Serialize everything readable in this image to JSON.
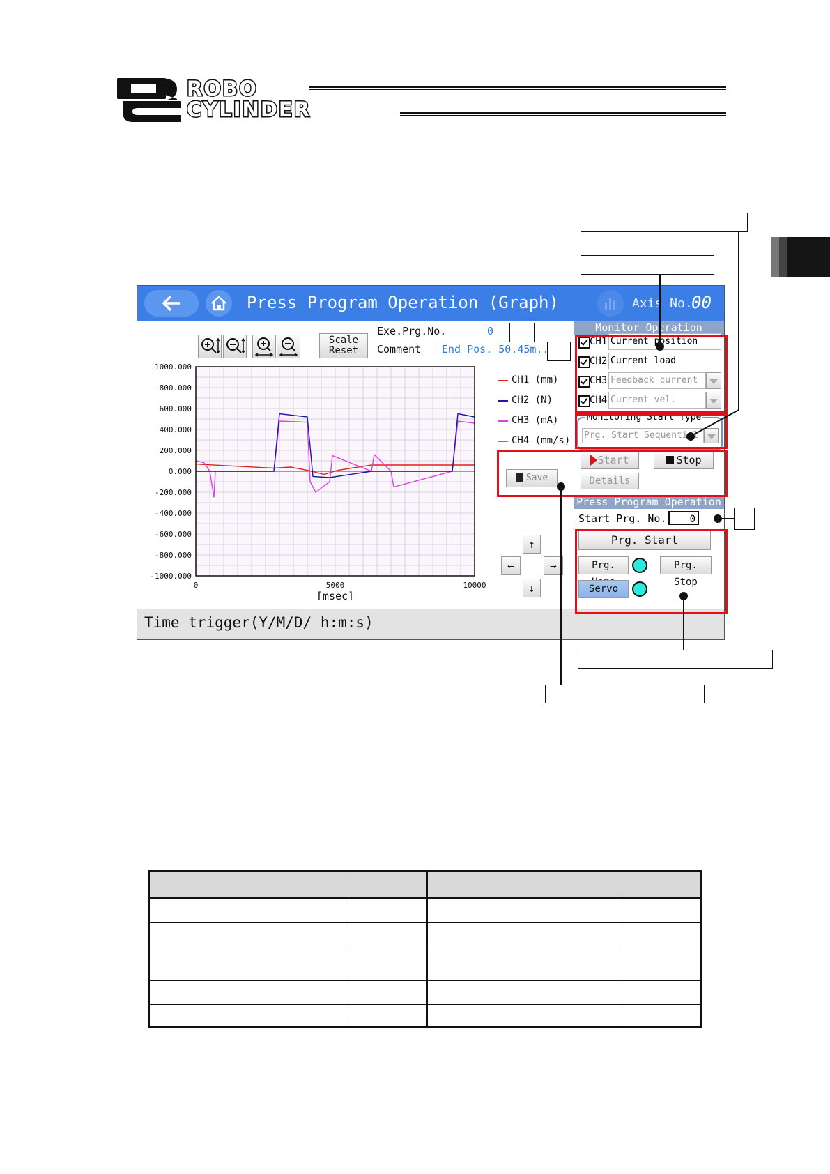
{
  "header": {
    "logo_line1": "ROBO",
    "logo_line2": "CYLINDER"
  },
  "screen": {
    "title": "Press Program Operation (Graph)",
    "axis_label": "Axis No.",
    "axis_value": "00",
    "zoom_icons": [
      "zoom-in-y-icon",
      "zoom-out-y-icon",
      "zoom-in-x-icon",
      "zoom-out-x-icon"
    ],
    "scale_reset_line1": "Scale",
    "scale_reset_line2": "Reset",
    "exe_prg_label": "Exe.Prg.No.",
    "exe_prg_value": "0",
    "comment_label": "Comment",
    "comment_value": "End Pos. 50.45m...",
    "save_label": "Save",
    "time_trigger": "Time trigger(Y/M/D/ h:m:s)",
    "monitor_operation": {
      "header": "Monitor Operation",
      "channels": [
        {
          "label": "CH1",
          "value": "Current position",
          "checked": true
        },
        {
          "label": "CH2",
          "value": "Current load",
          "checked": true
        },
        {
          "label": "CH3",
          "value": "Feedback current",
          "checked": true
        },
        {
          "label": "CH4",
          "value": "Current vel.",
          "checked": true
        }
      ],
      "start_type_label": "Monitoring Start Type",
      "start_type_value": "Prg. Start Sequential (",
      "start_label": "Start",
      "stop_label": "Stop",
      "details_label": "Details"
    },
    "press_program_operation": {
      "header": "Press Program Operation",
      "start_prg_label": "Start Prg. No.",
      "start_prg_value": "0",
      "prg_start_label": "Prg. Start",
      "prg_home_label": "Prg. Home",
      "prg_stop_label": "Prg. Stop",
      "servo_label": "Servo"
    },
    "colors": {
      "titlebar": "#3b7ee6",
      "highlight": "#e0101a",
      "led": "#2ee8e0",
      "ch1": "#e02020",
      "ch2": "#1a1aa8",
      "ch3": "#e040e0",
      "ch4": "#20c020"
    }
  },
  "chart_data": {
    "type": "line",
    "xlabel": "[msec]",
    "ylabel": "",
    "xlim": [
      0,
      10000
    ],
    "ylim": [
      -1000,
      1000
    ],
    "x_ticks": [
      "0",
      "5000",
      "10000"
    ],
    "y_ticks": [
      "1000.000",
      "800.000",
      "600.000",
      "400.000",
      "200.000",
      "0.000",
      "-200.000",
      "-400.000",
      "-600.000",
      "-800.000",
      "-1000.000"
    ],
    "grid": true,
    "legend_position": "right",
    "series": [
      {
        "name": "CH1 (mm)",
        "x": [
          0,
          300,
          2800,
          3400,
          4000,
          4600,
          5100,
          6300,
          7000,
          9200,
          10000
        ],
        "values": [
          70,
          65,
          30,
          40,
          10,
          -30,
          10,
          60,
          60,
          60,
          60
        ]
      },
      {
        "name": "CH2 (N)",
        "x": [
          0,
          500,
          700,
          2600,
          2800,
          3000,
          4000,
          4200,
          4800,
          6300,
          6500,
          9000,
          9200,
          9400,
          10000
        ],
        "values": [
          0,
          0,
          0,
          0,
          0,
          550,
          520,
          -50,
          -60,
          0,
          0,
          0,
          0,
          550,
          520
        ]
      },
      {
        "name": "CH3 (mA)",
        "x": [
          0,
          300,
          500,
          650,
          700,
          2800,
          3000,
          4000,
          4100,
          4300,
          4800,
          4900,
          6300,
          6400,
          7000,
          7100,
          9200,
          9400,
          10000
        ],
        "values": [
          100,
          80,
          0,
          -250,
          0,
          0,
          480,
          470,
          -100,
          -200,
          -100,
          150,
          0,
          160,
          0,
          -150,
          0,
          480,
          460
        ]
      },
      {
        "name": "CH4 (mm/s)",
        "x": [
          0,
          10000
        ],
        "values": [
          0,
          0
        ]
      }
    ]
  }
}
